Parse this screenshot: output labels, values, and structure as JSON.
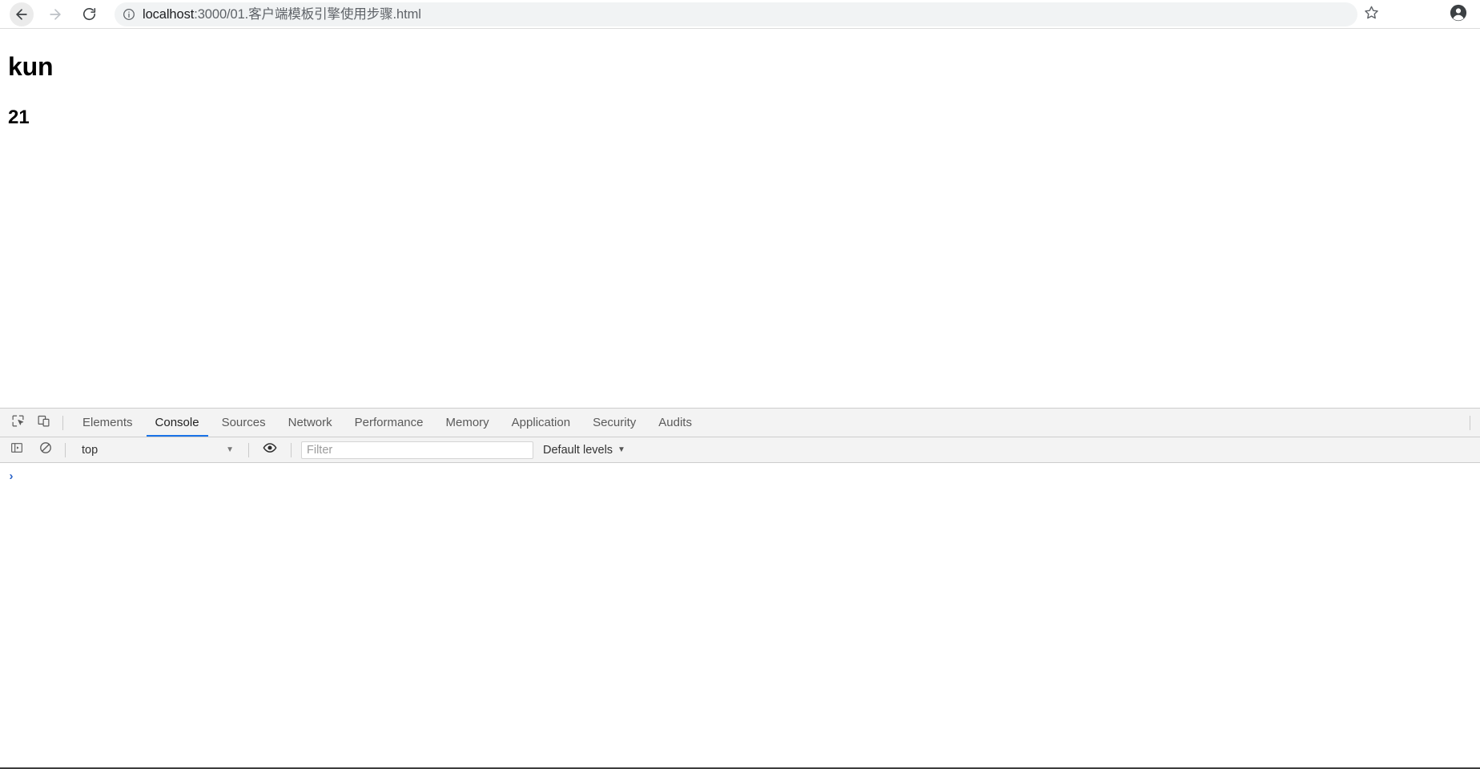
{
  "browser": {
    "back_label": "Back",
    "forward_label": "Forward",
    "reload_label": "Reload",
    "bookmark_label": "Bookmark this page",
    "profile_label": "Profile",
    "omnibox": {
      "info_label": "View site information",
      "url_host": "localhost",
      "url_rest": ":3000/01.客户端模板引擎使用步骤.html",
      "url_full": "localhost:3000/01.客户端模板引擎使用步骤.html"
    }
  },
  "page": {
    "heading1": "kun",
    "heading2": "21"
  },
  "devtools": {
    "inspect_label": "Inspect element",
    "device_label": "Toggle device toolbar",
    "tabs": [
      {
        "label": "Elements",
        "active": false
      },
      {
        "label": "Console",
        "active": true
      },
      {
        "label": "Sources",
        "active": false
      },
      {
        "label": "Network",
        "active": false
      },
      {
        "label": "Performance",
        "active": false
      },
      {
        "label": "Memory",
        "active": false
      },
      {
        "label": "Application",
        "active": false
      },
      {
        "label": "Security",
        "active": false
      },
      {
        "label": "Audits",
        "active": false
      }
    ],
    "active_tab": "Console",
    "accent_color": "#1a73e8",
    "console": {
      "sidebar_toggle_label": "Show console sidebar",
      "clear_label": "Clear console",
      "context_value": "top",
      "context_caret": "▼",
      "eye_label": "Create live expression",
      "filter_value": "",
      "filter_placeholder": "Filter",
      "levels_value": "Default levels",
      "levels_caret": "▼",
      "prompt_symbol": "›",
      "prompt_value": "",
      "messages": []
    }
  }
}
